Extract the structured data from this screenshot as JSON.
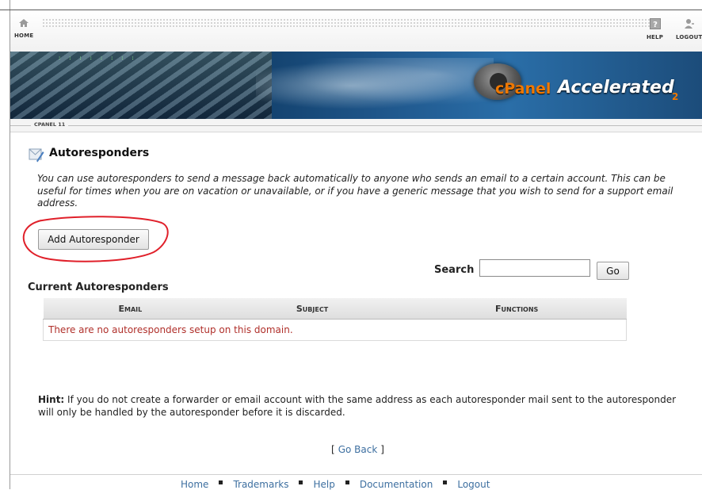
{
  "nav": {
    "home_label": "HOME",
    "help_label": "HELP",
    "logout_label": "LOGOUT"
  },
  "banner": {
    "logo_text": "cPanel",
    "logo_accel": "Accelerated",
    "logo_sub": "2"
  },
  "version_label": "CPANEL 11",
  "page": {
    "title": "Autoresponders",
    "description": "You can use autoresponders to send a message back automatically to anyone who sends an email to a certain account. This can be useful for times when you are on vacation or unavailable, or if you have a generic message that you wish to send for a support email address.",
    "add_button": "Add Autoresponder"
  },
  "search": {
    "label": "Search",
    "value": "",
    "go_label": "Go"
  },
  "table": {
    "section_title": "Current Autoresponders",
    "columns": [
      "Email",
      "Subject",
      "Functions"
    ],
    "empty_message": "There are no autoresponders setup on this domain."
  },
  "hint": {
    "label": "Hint:",
    "text": " If you do not create a forwarder or email account with the same address as each autoresponder mail sent to the autoresponder will only be handled by the autoresponder before it is discarded."
  },
  "goback": {
    "open": "[",
    "link": "Go Back",
    "close": "]"
  },
  "footer": {
    "links": [
      "Home",
      "Trademarks",
      "Help",
      "Documentation",
      "Logout"
    ]
  },
  "colors": {
    "link": "#3d6fa0",
    "error_text": "#b0302b",
    "annotation": "#e0202a",
    "logo_orange": "#f07800"
  },
  "icons": {
    "home": "home-icon",
    "help": "help-icon",
    "logout": "logout-icon",
    "page": "autoresponder-icon"
  }
}
